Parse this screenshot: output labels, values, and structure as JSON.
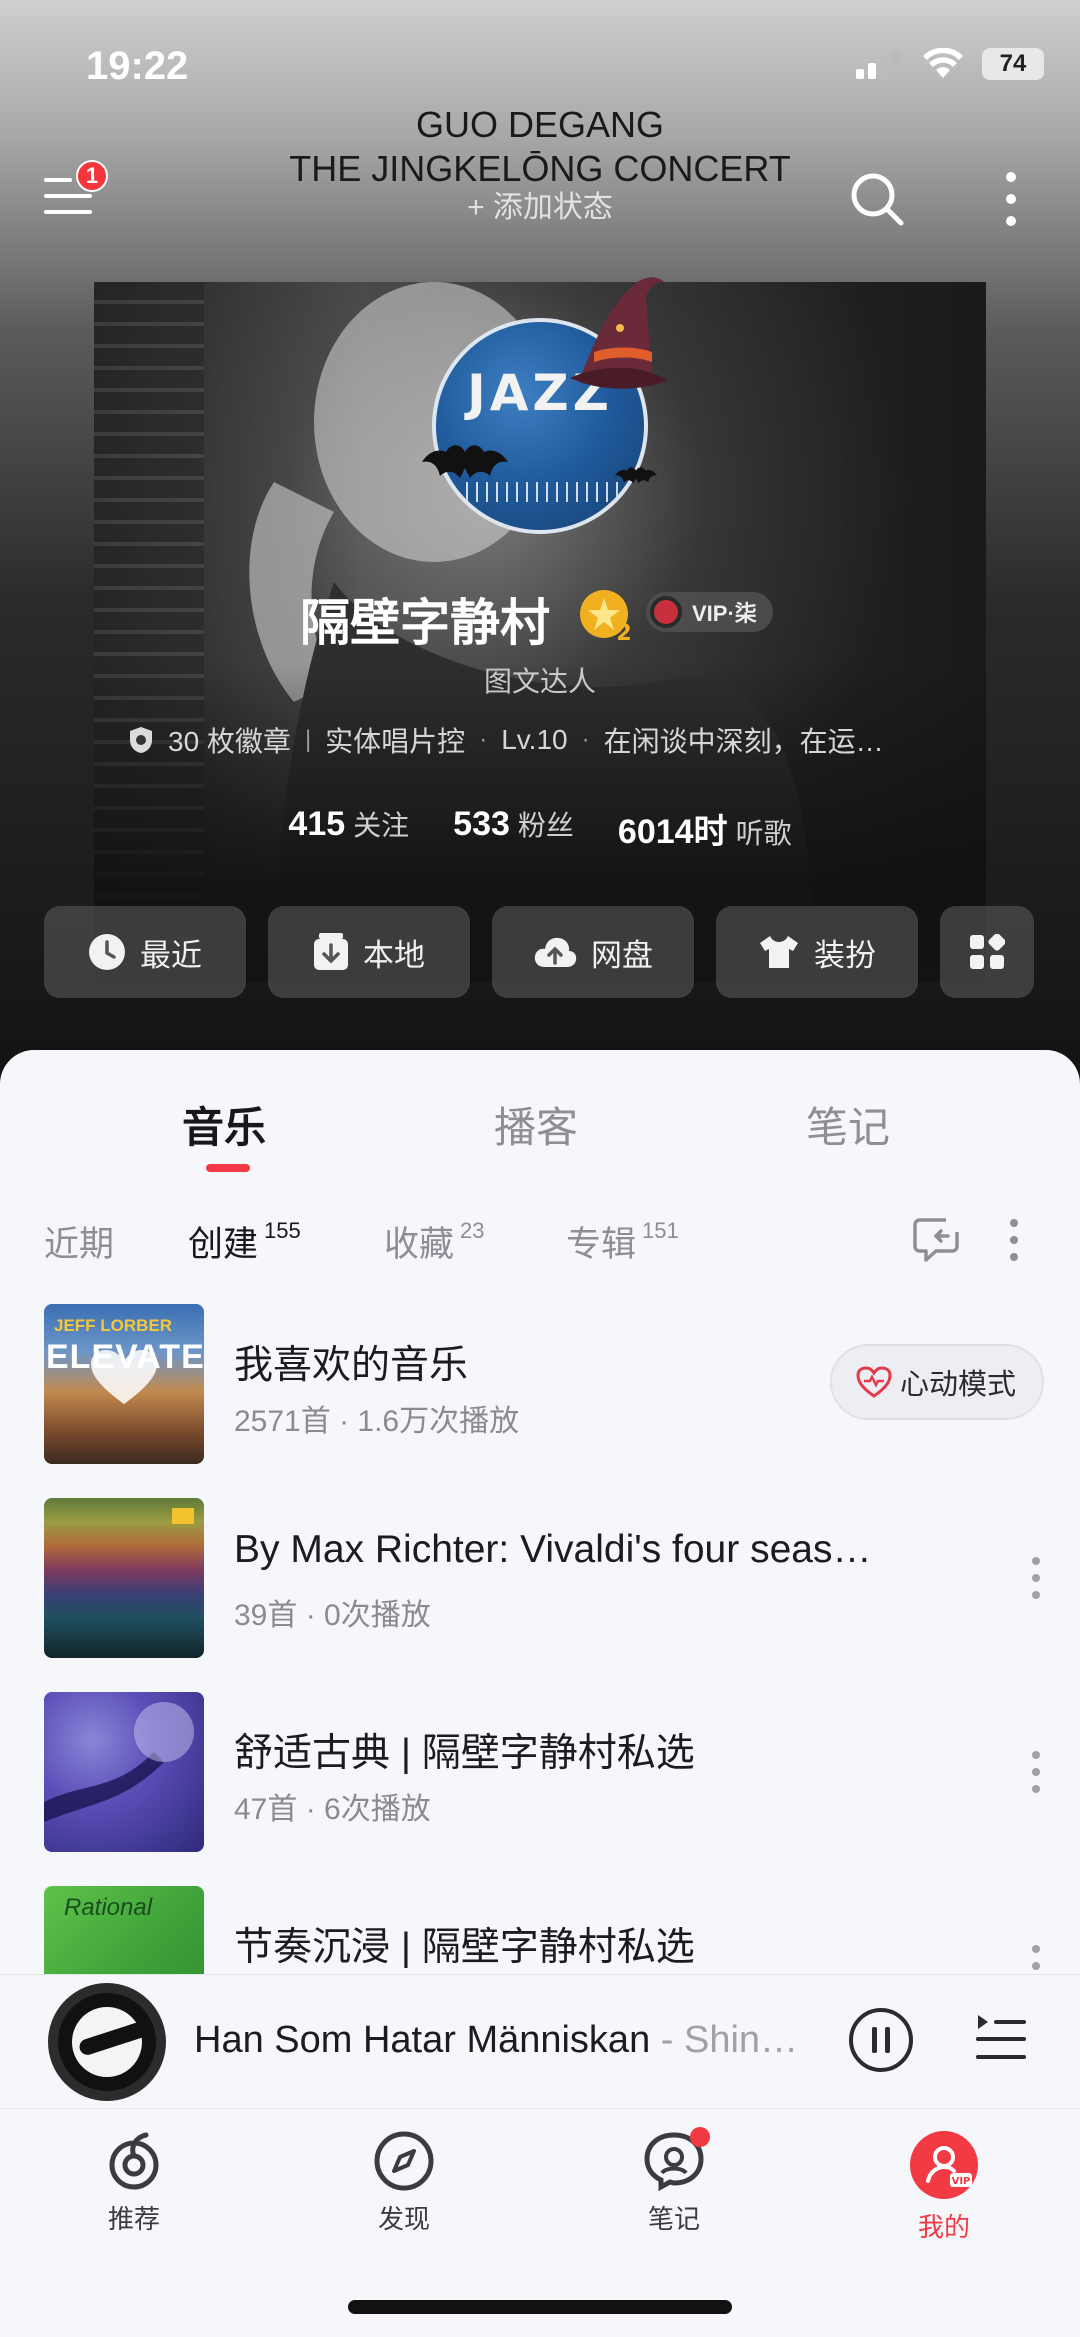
{
  "status_bar": {
    "time": "19:22",
    "battery": "74"
  },
  "header": {
    "concert_line1": "GUO DEGANG",
    "concert_line2": "THE JINGKELŌNG CONCERT",
    "add_status": "+ 添加状态",
    "menu_badge": "1"
  },
  "avatar": {
    "text": "JAZZ"
  },
  "profile": {
    "name": "隔壁字静村",
    "level_badge": "2",
    "vip": "VIP·柒",
    "tagline": "图文达人",
    "meta": {
      "badges": "30 枚徽章",
      "tag": "实体唱片控",
      "level": "Lv.10",
      "bio": "在闲谈中深刻，在运…"
    },
    "stats": [
      {
        "num": "415",
        "label": "关注"
      },
      {
        "num": "533",
        "label": "粉丝"
      },
      {
        "num": "6014时",
        "label": "听歌"
      }
    ]
  },
  "quick_actions": [
    {
      "label": "最近",
      "icon": "clock-icon"
    },
    {
      "label": "本地",
      "icon": "download-box-icon"
    },
    {
      "label": "网盘",
      "icon": "cloud-upload-icon"
    },
    {
      "label": "装扮",
      "icon": "tshirt-icon"
    },
    {
      "label": "",
      "icon": "grid-icon"
    }
  ],
  "main_tabs": [
    "音乐",
    "播客",
    "笔记"
  ],
  "sub_tabs": [
    {
      "label": "近期",
      "count": ""
    },
    {
      "label": "创建",
      "count": "155"
    },
    {
      "label": "收藏",
      "count": "23"
    },
    {
      "label": "专辑",
      "count": "151"
    }
  ],
  "playlists": [
    {
      "title": "我喜欢的音乐",
      "subtitle": "2571首 · 1.6万次播放",
      "cover_text": "ELEVATE",
      "cover_brand": "JEFF LORBER"
    },
    {
      "title": "By Max Richter: Vivaldi's four seas…",
      "subtitle": "39首 · 0次播放"
    },
    {
      "title": "舒适古典 | 隔壁字静村私选",
      "subtitle": "47首 · 6次播放"
    },
    {
      "title": "节奏沉浸 | 隔壁字静村私选",
      "subtitle": ""
    }
  ],
  "heart_mode": "心动模式",
  "now_playing": {
    "title": "Han Som Hatar Människan",
    "artist": " - Shin…"
  },
  "bottom_nav": [
    {
      "label": "推荐",
      "icon": "recommend-icon"
    },
    {
      "label": "发现",
      "icon": "compass-icon"
    },
    {
      "label": "笔记",
      "icon": "notes-chat-icon"
    },
    {
      "label": "我的",
      "icon": "profile-vip-icon"
    }
  ],
  "colors": {
    "accent": "#f33a45",
    "sheet_bg": "#f6f7fb"
  }
}
